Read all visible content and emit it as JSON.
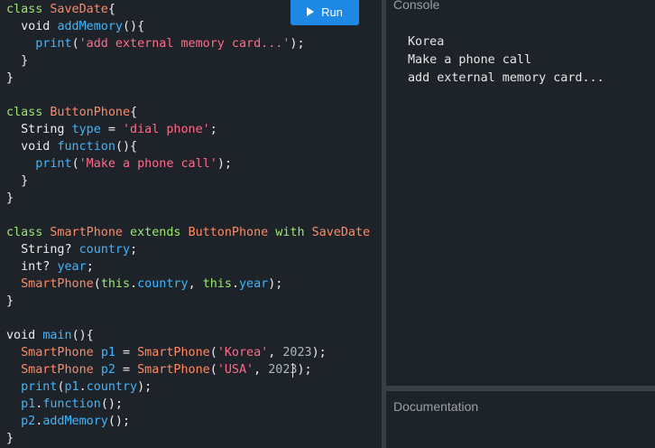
{
  "run_button": {
    "label": "Run"
  },
  "console": {
    "title": "Console",
    "output": [
      "Korea",
      "Make a phone call",
      "add external memory card..."
    ]
  },
  "documentation": {
    "title": "Documentation"
  },
  "colors": {
    "keyword": "#9be870",
    "class_name": "#ff8a65",
    "function_name": "#3fb6ff",
    "string": "#ff6b8a",
    "number": "#b0b7c0",
    "run_button": "#1e88e5"
  },
  "code": [
    {
      "tokens": [
        [
          "kw",
          "class "
        ],
        [
          "cls",
          "SaveDate"
        ],
        [
          "plain",
          "{"
        ]
      ]
    },
    {
      "tokens": [
        [
          "plain",
          "  void "
        ],
        [
          "fn",
          "addMemory"
        ],
        [
          "plain",
          "(){"
        ]
      ]
    },
    {
      "tokens": [
        [
          "fn",
          "    print"
        ],
        [
          "plain",
          "("
        ],
        [
          "str",
          "'add external memory card...'"
        ],
        [
          "plain",
          ");"
        ]
      ]
    },
    {
      "tokens": [
        [
          "plain",
          "  }"
        ]
      ]
    },
    {
      "tokens": [
        [
          "plain",
          "}"
        ]
      ]
    },
    {
      "tokens": []
    },
    {
      "tokens": [
        [
          "kw",
          "class "
        ],
        [
          "cls",
          "ButtonPhone"
        ],
        [
          "plain",
          "{"
        ]
      ]
    },
    {
      "tokens": [
        [
          "plain",
          "  String "
        ],
        [
          "fn",
          "type"
        ],
        [
          "plain",
          " = "
        ],
        [
          "str",
          "'dial phone'"
        ],
        [
          "plain",
          ";"
        ]
      ]
    },
    {
      "tokens": [
        [
          "plain",
          "  void "
        ],
        [
          "fn",
          "function"
        ],
        [
          "plain",
          "(){"
        ]
      ]
    },
    {
      "tokens": [
        [
          "fn",
          "    print"
        ],
        [
          "plain",
          "("
        ],
        [
          "str",
          "'Make a phone call'"
        ],
        [
          "plain",
          ");"
        ]
      ]
    },
    {
      "tokens": [
        [
          "plain",
          "  }"
        ]
      ]
    },
    {
      "tokens": [
        [
          "plain",
          "}"
        ]
      ]
    },
    {
      "tokens": []
    },
    {
      "tokens": [
        [
          "kw",
          "class "
        ],
        [
          "cls",
          "SmartPhone"
        ],
        [
          "kw",
          " extends "
        ],
        [
          "cls",
          "ButtonPhone"
        ],
        [
          "kw",
          " with "
        ],
        [
          "cls",
          "SaveDate"
        ]
      ]
    },
    {
      "tokens": [
        [
          "plain",
          "  String? "
        ],
        [
          "fn",
          "country"
        ],
        [
          "plain",
          ";"
        ]
      ]
    },
    {
      "tokens": [
        [
          "plain",
          "  int? "
        ],
        [
          "fn",
          "year"
        ],
        [
          "plain",
          ";"
        ]
      ]
    },
    {
      "tokens": [
        [
          "cls",
          "  SmartPhone"
        ],
        [
          "plain",
          "("
        ],
        [
          "kw",
          "this"
        ],
        [
          "plain",
          "."
        ],
        [
          "fn",
          "country"
        ],
        [
          "plain",
          ", "
        ],
        [
          "kw",
          "this"
        ],
        [
          "plain",
          "."
        ],
        [
          "fn",
          "year"
        ],
        [
          "plain",
          ");"
        ]
      ]
    },
    {
      "tokens": [
        [
          "plain",
          "}"
        ]
      ]
    },
    {
      "tokens": []
    },
    {
      "tokens": [
        [
          "plain",
          "void "
        ],
        [
          "fn",
          "main"
        ],
        [
          "plain",
          "(){"
        ]
      ]
    },
    {
      "tokens": [
        [
          "cls",
          "  SmartPhone "
        ],
        [
          "fn",
          "p1"
        ],
        [
          "plain",
          " = "
        ],
        [
          "cls",
          "SmartPhone"
        ],
        [
          "plain",
          "("
        ],
        [
          "str",
          "'Korea'"
        ],
        [
          "plain",
          ", "
        ],
        [
          "num",
          "2023"
        ],
        [
          "plain",
          ");"
        ]
      ]
    },
    {
      "tokens": [
        [
          "cls",
          "  SmartPhone "
        ],
        [
          "fn",
          "p2"
        ],
        [
          "plain",
          " = "
        ],
        [
          "cls",
          "SmartPhone"
        ],
        [
          "plain",
          "("
        ],
        [
          "str",
          "'USA'"
        ],
        [
          "plain",
          ", "
        ],
        [
          "num",
          "2023"
        ],
        [
          "plain",
          ");"
        ]
      ]
    },
    {
      "tokens": [
        [
          "fn",
          "  print"
        ],
        [
          "plain",
          "("
        ],
        [
          "fn",
          "p1"
        ],
        [
          "plain",
          "."
        ],
        [
          "fn",
          "country"
        ],
        [
          "plain",
          ");"
        ]
      ]
    },
    {
      "tokens": [
        [
          "fn",
          "  p1"
        ],
        [
          "plain",
          "."
        ],
        [
          "fn",
          "function"
        ],
        [
          "plain",
          "();"
        ]
      ]
    },
    {
      "tokens": [
        [
          "fn",
          "  p2"
        ],
        [
          "plain",
          "."
        ],
        [
          "fn",
          "addMemory"
        ],
        [
          "plain",
          "();"
        ]
      ]
    },
    {
      "tokens": [
        [
          "plain",
          "}"
        ]
      ]
    }
  ]
}
